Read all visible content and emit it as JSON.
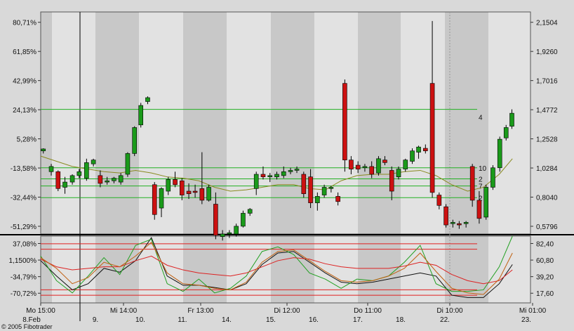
{
  "chart_data": {
    "type": "candlestick",
    "title": "",
    "copyright": "© 2005 Fibotrader",
    "colors": {
      "up": "#1a9a1a",
      "down": "#cc1111",
      "ma": "#8a8a20",
      "level": "#22b022",
      "osc_level": "#e02020",
      "osc_k": "#111111",
      "osc_d": "#22a022",
      "osc_r": "#dd2222",
      "osc_o": "#c06010"
    },
    "price_axis": {
      "left_ticks": [
        "80,71%",
        "61,85%",
        "42,99%",
        "24,13%",
        "5,28%",
        "-13,58%",
        "-32,44%",
        "-51,29%"
      ],
      "right_ticks": [
        "2,1504",
        "1,9260",
        "1,7016",
        "1,4772",
        "1,2528",
        "1,0284",
        "0,8040",
        "0,5796"
      ],
      "ylim": [
        0.52,
        2.23
      ]
    },
    "osc_axis": {
      "left_ticks": [
        "37,08%",
        "1,1500%",
        "-34,79%",
        "-70,72%"
      ],
      "right_ticks": [
        "82,40",
        "60,80",
        "39,20",
        "17,60"
      ],
      "ylim": [
        5,
        92
      ]
    },
    "x_axis": {
      "time_labels": [
        "Mo 15:00",
        "Mi 14:00",
        "Fr 13:00",
        "Di 12:00",
        "Do 11:00",
        "Di 10:00",
        "Mi 01:00"
      ],
      "date_labels": [
        "8.Feb",
        "9.",
        "10.",
        "11.",
        "14.",
        "15.",
        "16.",
        "17.",
        "18.",
        "22.",
        "23."
      ],
      "xlim": [
        0,
        100
      ]
    },
    "level_lines": [
      {
        "value": 1.48,
        "label": ""
      },
      {
        "value": 1.03,
        "label": "10"
      },
      {
        "value": 0.945,
        "label": "2"
      },
      {
        "value": 0.89,
        "label": "7"
      },
      {
        "value": 0.8,
        "label": "2"
      },
      {
        "value": 1.42,
        "label": "4"
      }
    ],
    "osc_levels": [
      82,
      75,
      22,
      15
    ],
    "candles": [
      {
        "x": 0.5,
        "o": 1.16,
        "h": 1.18,
        "l": 1.14,
        "c": 1.175
      },
      {
        "x": 2.0,
        "o": 1.0,
        "h": 1.06,
        "l": 0.97,
        "c": 1.04
      },
      {
        "x": 3.3,
        "o": 1.0,
        "h": 1.01,
        "l": 0.85,
        "c": 0.87
      },
      {
        "x": 4.6,
        "o": 0.88,
        "h": 0.96,
        "l": 0.83,
        "c": 0.92
      },
      {
        "x": 6.0,
        "o": 0.92,
        "h": 0.98,
        "l": 0.9,
        "c": 0.97
      },
      {
        "x": 7.3,
        "o": 0.97,
        "h": 1.02,
        "l": 0.95,
        "c": 1.0
      },
      {
        "x": 8.7,
        "o": 0.95,
        "h": 1.1,
        "l": 0.93,
        "c": 1.07
      },
      {
        "x": 10.0,
        "o": 1.06,
        "h": 1.1,
        "l": 1.04,
        "c": 1.09
      },
      {
        "x": 11.3,
        "o": 0.97,
        "h": 1.01,
        "l": 0.88,
        "c": 0.91
      },
      {
        "x": 12.6,
        "o": 0.92,
        "h": 0.96,
        "l": 0.9,
        "c": 0.93
      },
      {
        "x": 13.9,
        "o": 0.93,
        "h": 0.96,
        "l": 0.91,
        "c": 0.95
      },
      {
        "x": 15.2,
        "o": 0.92,
        "h": 0.99,
        "l": 0.9,
        "c": 0.97
      },
      {
        "x": 16.5,
        "o": 0.98,
        "h": 1.15,
        "l": 0.96,
        "c": 1.14
      },
      {
        "x": 17.8,
        "o": 1.14,
        "h": 1.35,
        "l": 1.12,
        "c": 1.34
      },
      {
        "x": 19.0,
        "o": 1.36,
        "h": 1.53,
        "l": 1.34,
        "c": 1.51
      },
      {
        "x": 20.3,
        "o": 1.54,
        "h": 1.58,
        "l": 1.52,
        "c": 1.57
      },
      {
        "x": 21.6,
        "o": 0.9,
        "h": 0.92,
        "l": 0.63,
        "c": 0.67
      },
      {
        "x": 22.9,
        "o": 0.72,
        "h": 0.88,
        "l": 0.65,
        "c": 0.87
      },
      {
        "x": 24.2,
        "o": 0.85,
        "h": 0.96,
        "l": 0.82,
        "c": 0.94
      },
      {
        "x": 25.5,
        "o": 0.94,
        "h": 1.0,
        "l": 0.88,
        "c": 0.9
      },
      {
        "x": 26.8,
        "o": 0.93,
        "h": 0.95,
        "l": 0.78,
        "c": 0.82
      },
      {
        "x": 28.1,
        "o": 0.85,
        "h": 0.91,
        "l": 0.79,
        "c": 0.83
      },
      {
        "x": 29.3,
        "o": 0.85,
        "h": 0.9,
        "l": 0.8,
        "c": 0.84
      },
      {
        "x": 30.6,
        "o": 0.87,
        "h": 1.15,
        "l": 0.75,
        "c": 0.78
      },
      {
        "x": 31.9,
        "o": 0.78,
        "h": 0.9,
        "l": 0.77,
        "c": 0.88
      },
      {
        "x": 33.2,
        "o": 0.75,
        "h": 0.84,
        "l": 0.48,
        "c": 0.51
      },
      {
        "x": 34.5,
        "o": 0.5,
        "h": 0.55,
        "l": 0.47,
        "c": 0.52
      },
      {
        "x": 35.8,
        "o": 0.52,
        "h": 0.55,
        "l": 0.49,
        "c": 0.53
      },
      {
        "x": 37.1,
        "o": 0.52,
        "h": 0.6,
        "l": 0.5,
        "c": 0.58
      },
      {
        "x": 38.4,
        "o": 0.58,
        "h": 0.7,
        "l": 0.57,
        "c": 0.68
      },
      {
        "x": 39.7,
        "o": 0.68,
        "h": 0.72,
        "l": 0.66,
        "c": 0.71
      },
      {
        "x": 40.9,
        "o": 0.87,
        "h": 1.0,
        "l": 0.82,
        "c": 0.98
      },
      {
        "x": 42.2,
        "o": 0.98,
        "h": 1.04,
        "l": 0.94,
        "c": 0.96
      },
      {
        "x": 43.5,
        "o": 0.96,
        "h": 0.99,
        "l": 0.92,
        "c": 0.97
      },
      {
        "x": 44.8,
        "o": 0.96,
        "h": 1.0,
        "l": 0.94,
        "c": 0.98
      },
      {
        "x": 46.1,
        "o": 0.97,
        "h": 1.04,
        "l": 0.95,
        "c": 1.0
      },
      {
        "x": 47.4,
        "o": 1.0,
        "h": 1.03,
        "l": 0.98,
        "c": 1.01
      },
      {
        "x": 48.6,
        "o": 1.01,
        "h": 1.04,
        "l": 0.99,
        "c": 1.02
      },
      {
        "x": 49.9,
        "o": 0.98,
        "h": 1.0,
        "l": 0.8,
        "c": 0.83
      },
      {
        "x": 51.2,
        "o": 0.96,
        "h": 1.02,
        "l": 0.72,
        "c": 0.76
      },
      {
        "x": 52.5,
        "o": 0.76,
        "h": 0.84,
        "l": 0.7,
        "c": 0.81
      },
      {
        "x": 53.8,
        "o": 0.82,
        "h": 0.9,
        "l": 0.8,
        "c": 0.88
      },
      {
        "x": 55.1,
        "o": 0.87,
        "h": 0.89,
        "l": 0.84,
        "c": 0.88
      },
      {
        "x": 56.4,
        "o": 0.81,
        "h": 0.84,
        "l": 0.74,
        "c": 0.77
      },
      {
        "x": 57.7,
        "o": 1.68,
        "h": 1.71,
        "l": 1.0,
        "c": 1.09
      },
      {
        "x": 58.9,
        "o": 1.09,
        "h": 1.12,
        "l": 0.98,
        "c": 1.02
      },
      {
        "x": 60.2,
        "o": 1.05,
        "h": 1.08,
        "l": 0.99,
        "c": 1.02
      },
      {
        "x": 61.5,
        "o": 1.03,
        "h": 1.06,
        "l": 1.0,
        "c": 1.04
      },
      {
        "x": 62.8,
        "o": 1.04,
        "h": 1.08,
        "l": 0.95,
        "c": 0.98
      },
      {
        "x": 64.1,
        "o": 0.99,
        "h": 1.12,
        "l": 0.97,
        "c": 1.1
      },
      {
        "x": 65.3,
        "o": 1.09,
        "h": 1.12,
        "l": 1.05,
        "c": 1.07
      },
      {
        "x": 66.6,
        "o": 1.01,
        "h": 1.04,
        "l": 0.78,
        "c": 0.85
      },
      {
        "x": 67.9,
        "o": 0.96,
        "h": 1.04,
        "l": 0.94,
        "c": 1.02
      },
      {
        "x": 69.2,
        "o": 1.02,
        "h": 1.1,
        "l": 1.0,
        "c": 1.09
      },
      {
        "x": 70.5,
        "o": 1.08,
        "h": 1.18,
        "l": 1.06,
        "c": 1.16
      },
      {
        "x": 71.7,
        "o": 1.15,
        "h": 1.2,
        "l": 1.1,
        "c": 1.19
      },
      {
        "x": 73.0,
        "o": 1.18,
        "h": 1.21,
        "l": 1.14,
        "c": 1.16
      },
      {
        "x": 74.3,
        "o": 1.68,
        "h": 2.16,
        "l": 0.8,
        "c": 0.84
      },
      {
        "x": 75.6,
        "o": 0.82,
        "h": 0.84,
        "l": 0.71,
        "c": 0.74
      },
      {
        "x": 76.9,
        "o": 0.73,
        "h": 0.75,
        "l": 0.57,
        "c": 0.59
      },
      {
        "x": 78.2,
        "o": 0.6,
        "h": 0.63,
        "l": 0.57,
        "c": 0.61
      },
      {
        "x": 79.4,
        "o": 0.6,
        "h": 0.62,
        "l": 0.56,
        "c": 0.59
      },
      {
        "x": 80.7,
        "o": 0.6,
        "h": 0.62,
        "l": 0.57,
        "c": 0.61
      },
      {
        "x": 81.9,
        "o": 1.04,
        "h": 1.06,
        "l": 0.73,
        "c": 0.78
      },
      {
        "x": 83.2,
        "o": 0.78,
        "h": 0.85,
        "l": 0.6,
        "c": 0.64
      },
      {
        "x": 84.5,
        "o": 0.65,
        "h": 0.9,
        "l": 0.63,
        "c": 0.88
      },
      {
        "x": 85.8,
        "o": 0.88,
        "h": 1.05,
        "l": 0.86,
        "c": 1.03
      },
      {
        "x": 87.1,
        "o": 1.03,
        "h": 1.27,
        "l": 1.0,
        "c": 1.25
      },
      {
        "x": 88.3,
        "o": 1.26,
        "h": 1.36,
        "l": 1.24,
        "c": 1.34
      },
      {
        "x": 89.4,
        "o": 1.35,
        "h": 1.48,
        "l": 1.33,
        "c": 1.45
      }
    ],
    "moving_average": [
      [
        0,
        1.12
      ],
      [
        3,
        1.08
      ],
      [
        6,
        1.04
      ],
      [
        9,
        1.02
      ],
      [
        12,
        1.0
      ],
      [
        15,
        0.99
      ],
      [
        18,
        1.01
      ],
      [
        21,
        0.99
      ],
      [
        24,
        0.96
      ],
      [
        27,
        0.95
      ],
      [
        30,
        0.93
      ],
      [
        33,
        0.88
      ],
      [
        36,
        0.85
      ],
      [
        39,
        0.86
      ],
      [
        42,
        0.88
      ],
      [
        45,
        0.9
      ],
      [
        48,
        0.9
      ],
      [
        51,
        0.87
      ],
      [
        54,
        0.86
      ],
      [
        57,
        0.93
      ],
      [
        60,
        0.97
      ],
      [
        63,
        0.98
      ],
      [
        66,
        0.98
      ],
      [
        69,
        1.0
      ],
      [
        72,
        1.01
      ],
      [
        75,
        0.97
      ],
      [
        78,
        0.9
      ],
      [
        81,
        0.85
      ],
      [
        84,
        0.88
      ],
      [
        87,
        0.98
      ],
      [
        89.5,
        1.1
      ]
    ],
    "osc_series": [
      {
        "key": "osc_k",
        "points": [
          [
            0,
            60
          ],
          [
            3,
            40
          ],
          [
            6,
            22
          ],
          [
            9,
            30
          ],
          [
            12,
            50
          ],
          [
            15,
            45
          ],
          [
            18,
            60
          ],
          [
            21,
            90
          ],
          [
            24,
            40
          ],
          [
            27,
            28
          ],
          [
            30,
            28
          ],
          [
            33,
            25
          ],
          [
            36,
            22
          ],
          [
            39,
            30
          ],
          [
            42,
            55
          ],
          [
            45,
            70
          ],
          [
            48,
            72
          ],
          [
            51,
            58
          ],
          [
            54,
            44
          ],
          [
            57,
            32
          ],
          [
            60,
            30
          ],
          [
            63,
            32
          ],
          [
            66,
            36
          ],
          [
            69,
            40
          ],
          [
            72,
            44
          ],
          [
            75,
            40
          ],
          [
            78,
            15
          ],
          [
            81,
            12
          ],
          [
            84,
            12
          ],
          [
            87,
            30
          ],
          [
            89.5,
            55
          ]
        ]
      },
      {
        "key": "osc_d",
        "points": [
          [
            0,
            66
          ],
          [
            3,
            34
          ],
          [
            6,
            18
          ],
          [
            9,
            40
          ],
          [
            12,
            64
          ],
          [
            15,
            42
          ],
          [
            18,
            80
          ],
          [
            21,
            88
          ],
          [
            24,
            30
          ],
          [
            27,
            20
          ],
          [
            30,
            36
          ],
          [
            33,
            18
          ],
          [
            36,
            24
          ],
          [
            39,
            40
          ],
          [
            42,
            72
          ],
          [
            45,
            78
          ],
          [
            48,
            68
          ],
          [
            51,
            44
          ],
          [
            54,
            36
          ],
          [
            57,
            24
          ],
          [
            60,
            36
          ],
          [
            63,
            34
          ],
          [
            66,
            40
          ],
          [
            69,
            58
          ],
          [
            72,
            80
          ],
          [
            75,
            30
          ],
          [
            78,
            20
          ],
          [
            81,
            20
          ],
          [
            84,
            22
          ],
          [
            87,
            52
          ],
          [
            89.5,
            92
          ]
        ]
      },
      {
        "key": "osc_r",
        "points": [
          [
            0,
            62
          ],
          [
            3,
            52
          ],
          [
            6,
            48
          ],
          [
            9,
            50
          ],
          [
            12,
            52
          ],
          [
            15,
            52
          ],
          [
            18,
            60
          ],
          [
            21,
            66
          ],
          [
            24,
            54
          ],
          [
            27,
            48
          ],
          [
            30,
            44
          ],
          [
            33,
            42
          ],
          [
            36,
            40
          ],
          [
            39,
            44
          ],
          [
            42,
            52
          ],
          [
            45,
            60
          ],
          [
            48,
            64
          ],
          [
            51,
            62
          ],
          [
            54,
            56
          ],
          [
            57,
            52
          ],
          [
            60,
            50
          ],
          [
            63,
            50
          ],
          [
            66,
            50
          ],
          [
            69,
            53
          ],
          [
            72,
            58
          ],
          [
            75,
            54
          ],
          [
            78,
            42
          ],
          [
            81,
            34
          ],
          [
            84,
            30
          ],
          [
            87,
            34
          ],
          [
            89.5,
            48
          ]
        ]
      },
      {
        "key": "osc_o",
        "points": [
          [
            0,
            64
          ],
          [
            3,
            50
          ],
          [
            6,
            30
          ],
          [
            9,
            38
          ],
          [
            12,
            58
          ],
          [
            15,
            52
          ],
          [
            18,
            66
          ],
          [
            21,
            84
          ],
          [
            24,
            44
          ],
          [
            27,
            30
          ],
          [
            30,
            28
          ],
          [
            33,
            24
          ],
          [
            36,
            22
          ],
          [
            39,
            32
          ],
          [
            42,
            58
          ],
          [
            45,
            72
          ],
          [
            48,
            74
          ],
          [
            51,
            60
          ],
          [
            54,
            46
          ],
          [
            57,
            34
          ],
          [
            60,
            32
          ],
          [
            63,
            34
          ],
          [
            66,
            40
          ],
          [
            69,
            50
          ],
          [
            72,
            70
          ],
          [
            75,
            46
          ],
          [
            78,
            24
          ],
          [
            81,
            18
          ],
          [
            84,
            16
          ],
          [
            87,
            36
          ],
          [
            89.5,
            70
          ]
        ]
      }
    ]
  }
}
